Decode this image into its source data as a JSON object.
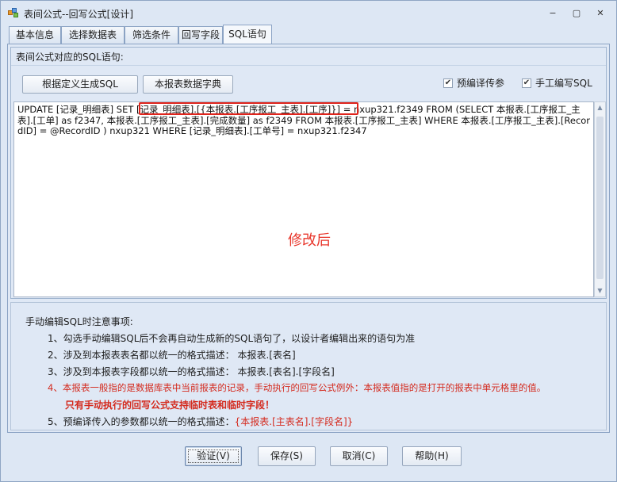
{
  "window": {
    "title": "表间公式--回写公式[设计]",
    "controls": {
      "minimize": "−",
      "restore": "▢",
      "close": "✕"
    }
  },
  "tabs": [
    {
      "label": "基本信息",
      "active": false
    },
    {
      "label": "选择数据表",
      "active": false
    },
    {
      "label": "筛选条件",
      "active": false
    },
    {
      "label": "回写字段",
      "active": false
    },
    {
      "label": "SQL语句",
      "active": true
    }
  ],
  "sql_panel": {
    "group_title": "表间公式对应的SQL语句:",
    "generate_button": "根据定义生成SQL",
    "dictionary_button": "本报表数据字典",
    "precompile_checkbox": {
      "label": "预编译传参",
      "checked": true
    },
    "manual_checkbox": {
      "label": "手工编写SQL",
      "checked": true
    },
    "sql_text": "UPDATE [记录_明细表] SET [记录_明细表].[{本报表.[工序报工_主表].[工序]}] = nxup321.f2349 FROM (SELECT  本报表.[工序报工_主表].[工单] as f2347, 本报表.[工序报工_主表].[完成数量] as f2349 FROM 本报表.[工序报工_主表] WHERE 本报表.[工序报工_主表].[RecordID] = @RecordID ) nxup321 WHERE [记录_明细表].[工单号] = nxup321.f2347",
    "annotation": "修改后"
  },
  "notes": {
    "heading": "手动编辑SQL时注意事项:",
    "item1": "1、勾选手动编辑SQL后不会再自动生成新的SQL语句了，以设计者编辑出来的语句为准",
    "item2": "2、涉及到本报表表名都以统一的格式描述：  本报表.[表名]",
    "item3": "3、涉及到本报表字段都以统一的格式描述：  本报表.[表名].[字段名]",
    "item4": "4、本报表一般指的是数据库表中当前报表的记录，手动执行的回写公式例外：本报表值指的是打开的报表中单元格里的值。",
    "item4b": "只有手动执行的回写公式支持临时表和临时字段！",
    "item5_prefix": "5、预编译传入的参数都以统一的格式描述：",
    "item5_value": "{本报表.[主表名].[字段名]}"
  },
  "footer": {
    "validate": "验证(V)",
    "save": "保存(S)",
    "cancel": "取消(C)",
    "help": "帮助(H)"
  },
  "colors": {
    "accent_red": "#e0251d",
    "window_bg": "#dde7f4"
  }
}
